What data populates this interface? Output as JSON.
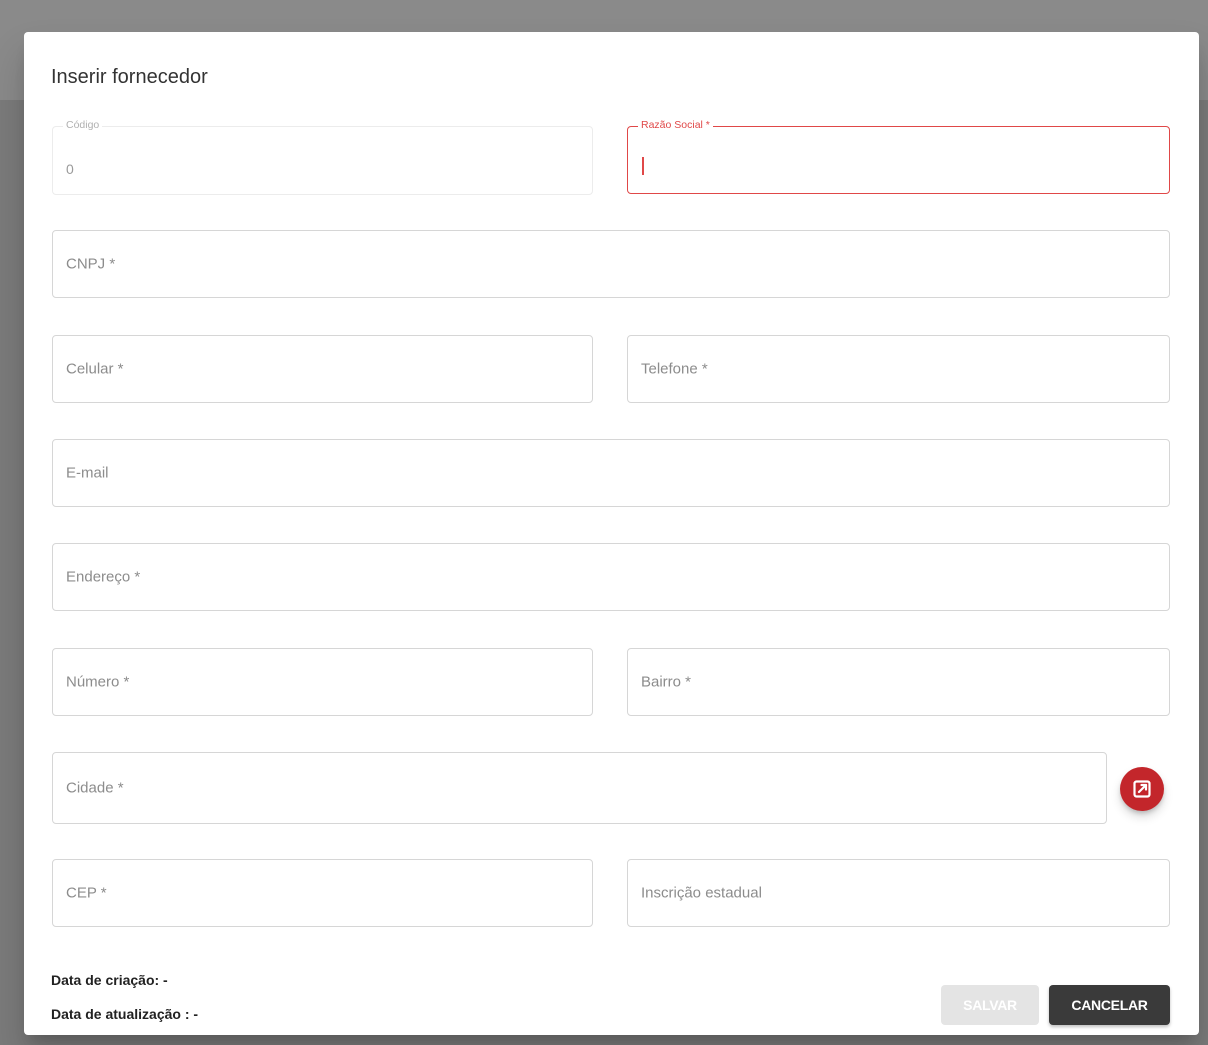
{
  "dialog": {
    "title": "Inserir fornecedor",
    "fields": {
      "codigo": {
        "label": "Código",
        "value": "0"
      },
      "razao_social": {
        "label": "Razão Social *",
        "value": ""
      },
      "cnpj": {
        "placeholder": "CNPJ *"
      },
      "celular": {
        "placeholder": "Celular *"
      },
      "telefone": {
        "placeholder": "Telefone *"
      },
      "email": {
        "placeholder": "E-mail"
      },
      "endereco": {
        "placeholder": "Endereço *"
      },
      "numero": {
        "placeholder": "Número *"
      },
      "bairro": {
        "placeholder": "Bairro *"
      },
      "cidade": {
        "placeholder": "Cidade *"
      },
      "cep": {
        "placeholder": "CEP *"
      },
      "inscricao_estadual": {
        "placeholder": "Inscrição estadual"
      }
    },
    "open_city_button_icon": "open-in-new-icon",
    "meta": {
      "created": "Data de criação: -",
      "updated": "Data de atualização : -"
    },
    "buttons": {
      "save": "SALVAR",
      "cancel": "CANCELAR"
    },
    "colors": {
      "accent": "#c3262b",
      "focus_border": "#e04848",
      "cancel_bg": "#3a3a3a",
      "save_disabled_bg": "#e4e4e4"
    }
  }
}
